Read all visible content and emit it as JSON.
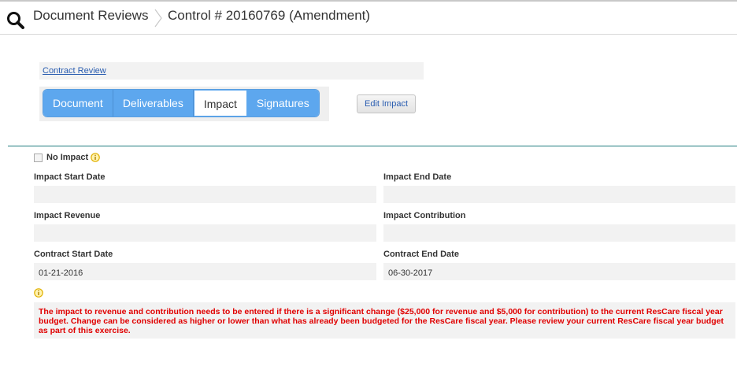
{
  "header": {
    "section": "Document Reviews",
    "title": "Control # 20160769  (Amendment)"
  },
  "contract_link": "Contract Review",
  "tabs": [
    {
      "label": "Document",
      "active": false
    },
    {
      "label": "Deliverables",
      "active": false
    },
    {
      "label": "Impact",
      "active": true
    },
    {
      "label": "Signatures",
      "active": false
    }
  ],
  "edit_button": "Edit Impact",
  "no_impact": {
    "label": "No Impact",
    "checked": false
  },
  "fields": {
    "impact_start": {
      "label": "Impact Start Date",
      "value": ""
    },
    "impact_end": {
      "label": "Impact End Date",
      "value": ""
    },
    "impact_revenue": {
      "label": "Impact Revenue",
      "value": ""
    },
    "impact_contribution": {
      "label": "Impact Contribution",
      "value": ""
    },
    "contract_start": {
      "label": "Contract Start Date",
      "value": "01-21-2016"
    },
    "contract_end": {
      "label": "Contract End Date",
      "value": "06-30-2017"
    }
  },
  "notice": "The impact to revenue and contribution needs to be entered if there is a significant change ($25,000 for revenue and $5,000 for contribution) to the current ResCare fiscal year budget. Change can be considered as higher or lower than what has already been budgeted for the ResCare fiscal year. Please review your current ResCare fiscal year budget as part of this exercise.",
  "colors": {
    "tab": "#5da7ee",
    "accent_rule": "#1e7b7e",
    "notice_text": "#e00000",
    "info": "#e0b000"
  },
  "icons": {
    "search": "search-icon",
    "info": "info-icon",
    "separator": "chevron-right-icon"
  }
}
